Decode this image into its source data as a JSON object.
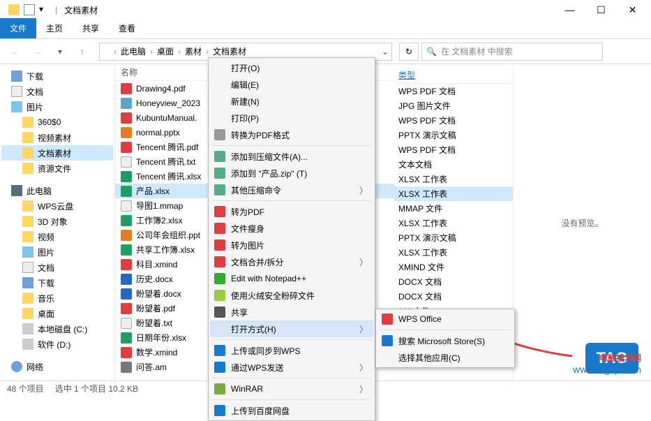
{
  "titlebar": {
    "title": "文档素材"
  },
  "window_controls": {
    "min": "—",
    "max": "☐",
    "close": "✕"
  },
  "ribbon": {
    "file": "文件",
    "home": "主页",
    "share": "共享",
    "view": "查看"
  },
  "address": {
    "crumbs": [
      "此电脑",
      "桌面",
      "素材",
      "文档素材"
    ]
  },
  "search": {
    "placeholder": "在 文档素材 中搜索"
  },
  "tree": [
    {
      "label": "下载",
      "icon": "ico-dl"
    },
    {
      "label": "文档",
      "icon": "ico-doc"
    },
    {
      "label": "图片",
      "icon": "ico-pic"
    },
    {
      "label": "360$0",
      "icon": "ico-folder",
      "indent": 1
    },
    {
      "label": "视频素材",
      "icon": "ico-folder",
      "indent": 1
    },
    {
      "label": "文档素材",
      "icon": "ico-folder",
      "indent": 1,
      "sel": true
    },
    {
      "label": "资源文件",
      "icon": "ico-folder",
      "indent": 1
    },
    {
      "label": "",
      "spacer": true
    },
    {
      "label": "此电脑",
      "icon": "ico-pc",
      "bold": true
    },
    {
      "label": "WPS云盘",
      "icon": "ico-folder",
      "indent": 1
    },
    {
      "label": "3D 对象",
      "icon": "ico-folder",
      "indent": 1
    },
    {
      "label": "视频",
      "icon": "ico-folder",
      "indent": 1
    },
    {
      "label": "图片",
      "icon": "ico-pic",
      "indent": 1
    },
    {
      "label": "文档",
      "icon": "ico-doc",
      "indent": 1
    },
    {
      "label": "下载",
      "icon": "ico-dl",
      "indent": 1
    },
    {
      "label": "音乐",
      "icon": "ico-folder",
      "indent": 1
    },
    {
      "label": "桌面",
      "icon": "ico-folder",
      "indent": 1
    },
    {
      "label": "本地磁盘 (C:)",
      "icon": "ico-drive",
      "indent": 1
    },
    {
      "label": "软件 (D:)",
      "icon": "ico-drive",
      "indent": 1
    },
    {
      "label": "",
      "spacer": true
    },
    {
      "label": "网络",
      "icon": "ico-net"
    }
  ],
  "columns": {
    "name": "名称",
    "type": "类型"
  },
  "files": [
    {
      "name": "Drawing4.pdf",
      "type": "WPS PDF 文档",
      "cls": "pdf"
    },
    {
      "name": "Honeyview_2023",
      "type": "JPG 图片文件",
      "cls": "jpg"
    },
    {
      "name": "KubuntuManual.",
      "type": "WPS PDF 文档",
      "cls": "pdf"
    },
    {
      "name": "normal.pptx",
      "type": "PPTX 演示文稿",
      "cls": "pptx"
    },
    {
      "name": "Tencent 腾讯.pdf",
      "type": "WPS PDF 文档",
      "cls": "pdf"
    },
    {
      "name": "Tencent 腾讯.txt",
      "type": "文本文档",
      "cls": "txt"
    },
    {
      "name": "Tencent 腾讯.xlsx",
      "type": "XLSX 工作表",
      "cls": "xlsx"
    },
    {
      "name": "产品.xlsx",
      "type": "XLSX 工作表",
      "cls": "xlsx",
      "sel": true
    },
    {
      "name": "导图1.mmap",
      "type": "MMAP 文件",
      "cls": "mmap"
    },
    {
      "name": "工作簿2.xlsx",
      "type": "XLSX 工作表",
      "cls": "xlsx"
    },
    {
      "name": "公司年会组织.ppt",
      "type": "PPTX 演示文稿",
      "cls": "pptx"
    },
    {
      "name": "共享工作簿.xlsx",
      "type": "XLSX 工作表",
      "cls": "xlsx"
    },
    {
      "name": "科目.xmind",
      "type": "XMIND 文件",
      "cls": "xmind"
    },
    {
      "name": "历史.docx",
      "type": "DOCX 文档",
      "cls": "docx"
    },
    {
      "name": "盼望着.docx",
      "type": "DOCX 文档",
      "cls": "docx"
    },
    {
      "name": "盼望着.pdf",
      "type": "",
      "cls": "pdf"
    },
    {
      "name": "盼望着.txt",
      "type": "",
      "cls": "txt"
    },
    {
      "name": "日期年份.xlsx",
      "type": "",
      "cls": "xlsx"
    },
    {
      "name": "数学.xmind",
      "type": "",
      "cls": "xmind"
    },
    {
      "name": "问答.am",
      "type": "AM 文件",
      "cls": "am"
    }
  ],
  "preview": {
    "empty": "没有预览。"
  },
  "contextmenu": [
    {
      "label": "打开(O)"
    },
    {
      "label": "编辑(E)"
    },
    {
      "label": "新建(N)"
    },
    {
      "label": "打印(P)"
    },
    {
      "label": "转换为PDF格式",
      "icon": "#999"
    },
    {
      "sep": true
    },
    {
      "label": "添加到压缩文件(A)...",
      "icon": "#5a8"
    },
    {
      "label": "添加到 \"产品.zip\" (T)",
      "icon": "#5a8"
    },
    {
      "label": "其他压缩命令",
      "icon": "#5a8",
      "arrow": true
    },
    {
      "sep": true
    },
    {
      "label": "转为PDF",
      "icon": "#e03e3e"
    },
    {
      "label": "文件瘦身",
      "icon": "#e03e3e"
    },
    {
      "label": "转为图片",
      "icon": "#e03e3e"
    },
    {
      "label": "文档合并/拆分",
      "icon": "#e03e3e",
      "arrow": true
    },
    {
      "label": "Edit with Notepad++",
      "icon": "#3a3"
    },
    {
      "label": "使用火绒安全粉碎文件",
      "icon": "#9c4"
    },
    {
      "label": "共享",
      "icon": "#555"
    },
    {
      "label": "打开方式(H)",
      "arrow": true,
      "highlight": true
    },
    {
      "sep": true
    },
    {
      "label": "上传或同步到WPS",
      "icon": "#1979ca"
    },
    {
      "label": "通过WPS发送",
      "icon": "#1979ca",
      "arrow": true
    },
    {
      "sep": true
    },
    {
      "label": "WinRAR",
      "icon": "#7a4",
      "arrow": true
    },
    {
      "sep": true
    },
    {
      "label": "上传到百度网盘",
      "icon": "#1979ca"
    }
  ],
  "submenu": [
    {
      "label": "WPS Office",
      "icon": "#e03e3e"
    },
    {
      "sep": true
    },
    {
      "label": "搜索 Microsoft Store(S)",
      "icon": "#1979ca"
    },
    {
      "label": "选择其他应用(C)"
    }
  ],
  "status": {
    "count": "48 个项目",
    "selected": "选中 1 个项目  10.2 KB"
  },
  "watermark": {
    "line1": "电脑技术网",
    "line2": "www.tagxp.com"
  },
  "tag": "TAG"
}
